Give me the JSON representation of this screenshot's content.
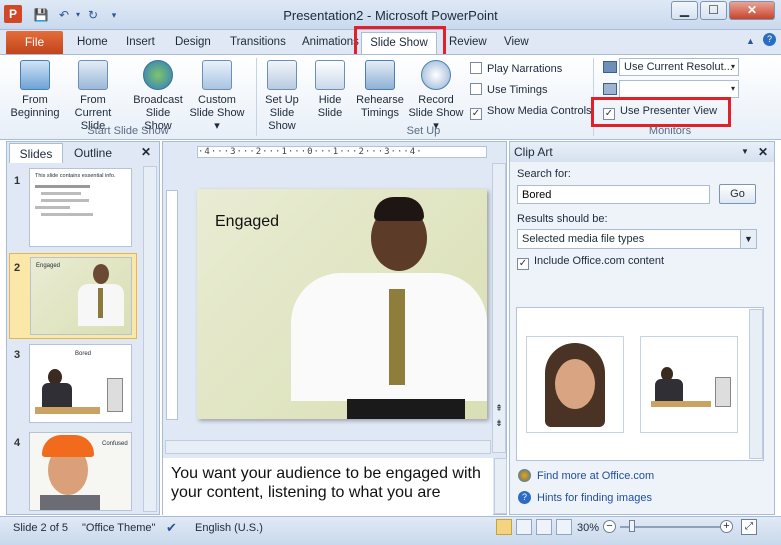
{
  "window": {
    "title": "Presentation2 - Microsoft PowerPoint",
    "app_icon": "P",
    "min": "▁",
    "max": "☐",
    "close": "✕"
  },
  "tabs": {
    "file": "File",
    "items": [
      "Home",
      "Insert",
      "Design",
      "Transitions",
      "Animations",
      "Slide Show",
      "Review",
      "View"
    ]
  },
  "ribbon": {
    "start": {
      "from_beginning": [
        "From",
        "Beginning"
      ],
      "from_current": [
        "From",
        "Current Slide"
      ],
      "broadcast": [
        "Broadcast",
        "Slide Show"
      ],
      "custom": [
        "Custom",
        "Slide Show ▾"
      ],
      "group": "Start Slide Show"
    },
    "setup": {
      "setup_show": [
        "Set Up",
        "Slide Show"
      ],
      "hide_slide": [
        "Hide",
        "Slide"
      ],
      "rehearse": [
        "Rehearse",
        "Timings"
      ],
      "record": [
        "Record",
        "Slide Show ▾"
      ],
      "play_narrations": "Play Narrations",
      "use_timings": "Use Timings",
      "show_media_controls": "Show Media Controls",
      "group": "Set Up"
    },
    "monitors": {
      "resolution": "Use Current Resolut...",
      "presenter_view": "Use Presenter View",
      "group": "Monitors"
    }
  },
  "left_pane": {
    "tab_slides": "Slides",
    "tab_outline": "Outline",
    "close": "✕",
    "thumbs": [
      {
        "num": "1",
        "title": "This slide contains essential info."
      },
      {
        "num": "2",
        "title": "Engaged"
      },
      {
        "num": "3",
        "title": "Bored"
      },
      {
        "num": "4",
        "title": "Confused"
      }
    ]
  },
  "slide": {
    "title": "Engaged"
  },
  "ruler": "·4···3···2···1···0···1···2···3···4·",
  "notes": "You want your audience to be engaged with your content, listening to what you are",
  "clipart": {
    "title": "Clip Art",
    "search_label": "Search for:",
    "search_value": "Bored",
    "go": "Go",
    "results_label": "Results should be:",
    "results_value": "Selected media file types",
    "include_label": "Include Office.com content",
    "find_more": "Find more at Office.com",
    "hints": "Hints for finding images"
  },
  "status": {
    "slide": "Slide 2 of 5",
    "theme": "\"Office Theme\"",
    "language": "English (U.S.)",
    "zoom": "30%"
  },
  "colors": {
    "highlight": "#e2202a",
    "file_tab": "#d24726",
    "accent": "#2b579a"
  }
}
